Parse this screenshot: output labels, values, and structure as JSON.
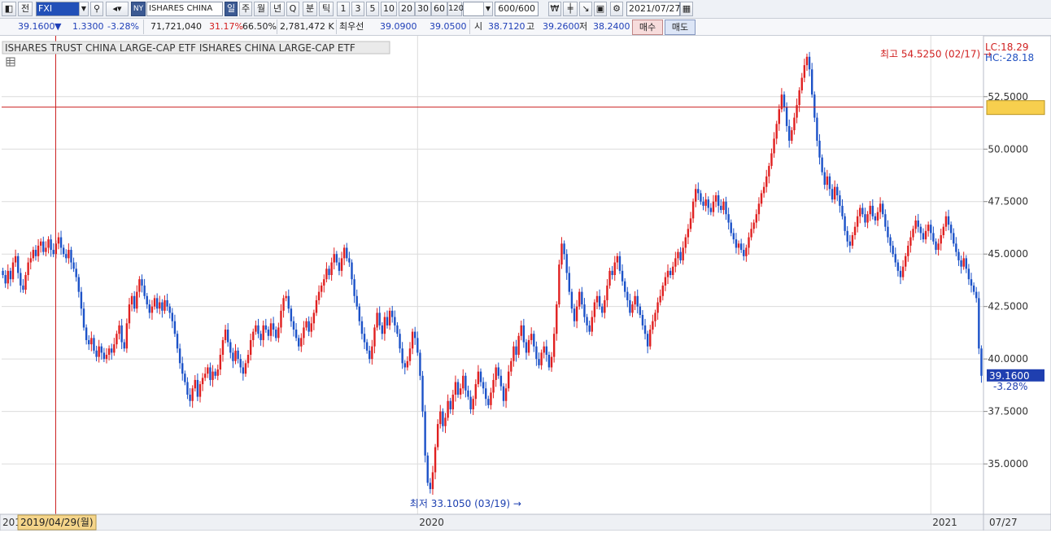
{
  "toolbar": {
    "title_btn1": "전",
    "ticker": "FXI",
    "exchange": "NY",
    "name": "ISHARES CHINA",
    "periods": [
      "일",
      "주",
      "월",
      "년",
      "Q",
      "분",
      "틱"
    ],
    "minute_steps": [
      "1",
      "3",
      "5",
      "10",
      "20",
      "30",
      "60",
      "120"
    ],
    "count": "600/600",
    "date": "2021/07/27"
  },
  "quote": {
    "price": "39.1600",
    "change_sign": "▼",
    "change": "1.3300",
    "change_pct": "-3.28%",
    "volume": "71,721,040",
    "volume_ratio": "31.17%",
    "ratio2": "66.50%",
    "amount": "2,781,472 K",
    "best_bid_label": "최우선",
    "best_ask": "39.0900",
    "best_bid": "39.0500",
    "open_label": "시",
    "open": "38.7120",
    "high_label": "고",
    "high": "39.2600",
    "low_label": "저",
    "low": "38.2400",
    "buy_label": "매수",
    "sell_label": "매도"
  },
  "chart_data": {
    "type": "candlestick",
    "title": "ISHARES TRUST CHINA LARGE-CAP ETF  ISHARES CHINA LARGE-CAP ETF",
    "y_ticks": [
      "35.0000",
      "37.5000",
      "40.0000",
      "42.5000",
      "45.0000",
      "47.5000",
      "50.0000",
      "52.5000"
    ],
    "ylim": [
      32.6,
      55.4
    ],
    "x_ticks": [
      {
        "label": "2020",
        "i": 164
      },
      {
        "label": "2021",
        "i": 367
      }
    ],
    "x_start_label": "2019/04/29(월)",
    "x_end_label": "07/27",
    "x_left_partial": "201",
    "max_label": "최고 54.5250 (02/17)",
    "min_label": "최저 33.1050 (03/19)",
    "max": {
      "i": 393,
      "value": 54.525
    },
    "min": {
      "i": 207,
      "value": 33.105
    },
    "hline_value": 52.0,
    "lc_label": "LC:18.29",
    "hc_label": "HC:-28.18",
    "last_price_label": "39.1600",
    "last_change_label": "-3.28%",
    "colors": {
      "up": "#e02020",
      "down": "#1c52c8",
      "grid": "#dcdcdc",
      "hline": "#cc2222",
      "crosshair": "#cc2222"
    },
    "closes": [
      44.0,
      43.6,
      44.2,
      43.8,
      44.6,
      44.9,
      44.1,
      43.5,
      43.3,
      44.0,
      44.6,
      44.8,
      45.2,
      44.9,
      45.4,
      45.6,
      45.1,
      45.3,
      45.7,
      45.2,
      45.0,
      45.5,
      45.8,
      45.3,
      45.0,
      44.8,
      45.2,
      44.6,
      44.3,
      43.9,
      43.2,
      42.4,
      41.5,
      40.9,
      40.7,
      41.0,
      40.4,
      40.1,
      40.6,
      40.3,
      40.0,
      40.2,
      40.5,
      40.3,
      40.7,
      41.2,
      41.6,
      40.8,
      40.5,
      41.7,
      42.6,
      43.0,
      42.4,
      43.2,
      43.8,
      43.5,
      43.0,
      42.6,
      42.2,
      42.5,
      42.9,
      42.4,
      42.7,
      42.3,
      42.8,
      42.5,
      42.2,
      41.8,
      41.2,
      40.5,
      39.8,
      39.3,
      38.9,
      38.3,
      38.0,
      38.6,
      39.0,
      38.2,
      38.8,
      39.1,
      39.3,
      39.6,
      39.0,
      39.4,
      39.2,
      39.5,
      40.2,
      40.9,
      41.4,
      40.8,
      40.3,
      39.9,
      40.4,
      40.0,
      39.6,
      39.3,
      39.8,
      40.2,
      40.9,
      41.3,
      41.6,
      41.2,
      40.9,
      41.6,
      41.4,
      41.1,
      41.7,
      41.4,
      41.0,
      41.5,
      42.3,
      42.9,
      43.0,
      42.4,
      41.8,
      41.4,
      41.0,
      40.6,
      41.0,
      41.5,
      41.8,
      41.3,
      41.7,
      42.2,
      42.8,
      43.2,
      43.5,
      43.8,
      44.3,
      44.0,
      44.6,
      45.0,
      44.6,
      44.2,
      44.8,
      45.3,
      44.8,
      44.6,
      43.8,
      43.0,
      42.5,
      41.8,
      41.2,
      40.8,
      40.4,
      40.0,
      40.6,
      41.5,
      42.2,
      41.6,
      41.2,
      42.0,
      41.6,
      42.3,
      42.0,
      41.6,
      41.2,
      40.5,
      39.8,
      39.6,
      39.9,
      40.5,
      41.3,
      41.0,
      40.3,
      39.2,
      37.5,
      35.4,
      34.1,
      33.8,
      34.6,
      35.8,
      36.9,
      37.5,
      36.8,
      37.2,
      38.0,
      37.6,
      38.3,
      38.9,
      38.3,
      38.6,
      39.2,
      38.5,
      38.2,
      37.6,
      38.1,
      38.8,
      39.4,
      38.9,
      38.6,
      38.1,
      37.8,
      38.4,
      39.0,
      39.6,
      39.2,
      38.7,
      38.0,
      38.6,
      39.4,
      39.9,
      40.6,
      40.2,
      41.1,
      41.6,
      40.8,
      40.3,
      40.9,
      41.2,
      40.6,
      40.0,
      39.7,
      40.3,
      40.6,
      40.2,
      39.6,
      40.1,
      41.2,
      42.6,
      44.5,
      45.5,
      45.0,
      44.1,
      43.2,
      42.4,
      41.8,
      42.5,
      43.2,
      42.6,
      42.0,
      41.6,
      41.3,
      42.0,
      42.7,
      43.0,
      42.5,
      42.2,
      42.8,
      43.5,
      44.2,
      44.0,
      44.6,
      44.9,
      44.2,
      43.7,
      43.2,
      42.8,
      42.2,
      42.6,
      43.0,
      42.5,
      42.1,
      41.6,
      41.2,
      40.6,
      41.4,
      41.8,
      42.2,
      42.7,
      43.0,
      43.5,
      43.9,
      44.2,
      44.0,
      44.4,
      44.8,
      45.1,
      44.7,
      45.3,
      45.8,
      46.2,
      46.7,
      47.5,
      48.1,
      47.9,
      47.5,
      47.3,
      47.6,
      47.2,
      47.0,
      47.5,
      47.8,
      47.3,
      47.1,
      47.5,
      46.9,
      46.5,
      46.0,
      45.7,
      45.3,
      45.5,
      45.2,
      44.9,
      45.3,
      45.8,
      46.2,
      46.5,
      46.9,
      47.4,
      47.9,
      48.2,
      48.7,
      49.2,
      49.8,
      50.5,
      51.2,
      51.9,
      52.6,
      52.0,
      51.1,
      50.4,
      50.9,
      51.5,
      52.1,
      52.8,
      53.4,
      54.0,
      54.4,
      53.8,
      52.6,
      51.5,
      50.4,
      49.6,
      48.9,
      48.3,
      48.7,
      48.1,
      47.6,
      48.2,
      47.8,
      47.3,
      46.8,
      46.1,
      45.6,
      45.4,
      45.9,
      46.3,
      46.8,
      47.2,
      46.9,
      46.5,
      46.9,
      47.3,
      46.8,
      46.6,
      47.0,
      47.4,
      46.9,
      46.3,
      45.8,
      45.4,
      45.0,
      44.6,
      44.2,
      43.9,
      44.4,
      44.9,
      45.4,
      45.8,
      46.2,
      46.6,
      46.3,
      46.0,
      45.7,
      46.1,
      46.4,
      46.0,
      45.6,
      45.2,
      45.5,
      45.9,
      46.3,
      46.8,
      46.4,
      46.0,
      45.5,
      45.1,
      44.7,
      44.4,
      44.8,
      44.3,
      43.8,
      43.5,
      43.2,
      42.9,
      40.5,
      39.2
    ]
  }
}
